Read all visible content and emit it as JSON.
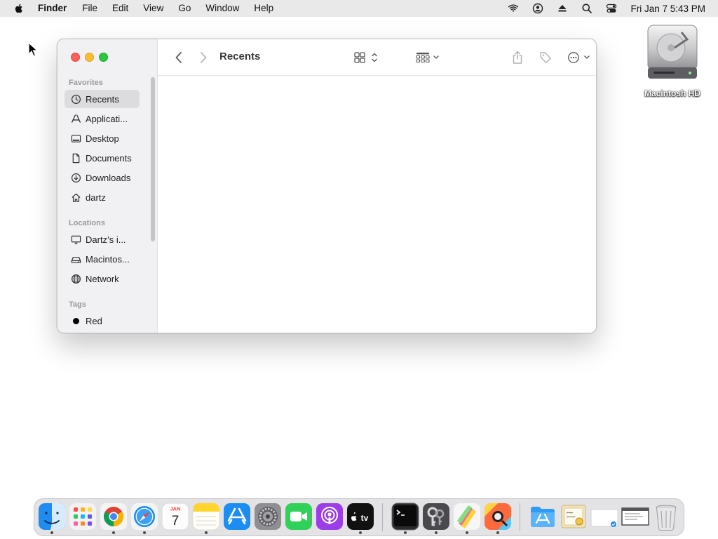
{
  "menubar": {
    "app_name": "Finder",
    "items": [
      "File",
      "Edit",
      "View",
      "Go",
      "Window",
      "Help"
    ],
    "clock": "Fri Jan 7  5:43 PM",
    "status_icons": [
      "wifi-icon",
      "user-icon",
      "eject-icon",
      "spotlight-icon",
      "control-center-icon"
    ]
  },
  "desktop": {
    "disk_label": "Macintosh HD"
  },
  "window": {
    "title": "Recents",
    "sidebar": {
      "favorites_header": "Favorites",
      "locations_header": "Locations",
      "tags_header": "Tags",
      "favorites": [
        {
          "label": "Recents",
          "icon": "clock-icon",
          "selected": true
        },
        {
          "label": "Applicati...",
          "icon": "applications-icon"
        },
        {
          "label": "Desktop",
          "icon": "desktop-icon"
        },
        {
          "label": "Documents",
          "icon": "document-icon"
        },
        {
          "label": "Downloads",
          "icon": "download-icon"
        },
        {
          "label": "dartz",
          "icon": "home-icon"
        }
      ],
      "locations": [
        {
          "label": "Dartz’s i...",
          "icon": "computer-icon"
        },
        {
          "label": "Macintos...",
          "icon": "disk-icon"
        },
        {
          "label": "Network",
          "icon": "globe-icon"
        }
      ],
      "tags": [
        {
          "label": "Red",
          "icon": "tag-dot-icon",
          "color": "#000000"
        }
      ]
    }
  },
  "dock": {
    "apps": [
      "Finder",
      "Launchpad",
      "Chrome",
      "Safari",
      "Calendar",
      "Notes",
      "App Store",
      "System Preferences",
      "FaceTime",
      "Podcasts",
      "TV",
      "Terminal",
      "Keychain Access",
      "Script Editor",
      "Utility",
      "Applications",
      "Preview",
      "Untitled",
      "Screenshot",
      "Trash"
    ],
    "calendar_month": "JAN",
    "calendar_day": "7",
    "tv_label": "tv"
  },
  "colors": {
    "accent": "#0a84ff",
    "close": "#fe5f57",
    "minimize": "#febc2e",
    "maximize": "#28c840"
  }
}
